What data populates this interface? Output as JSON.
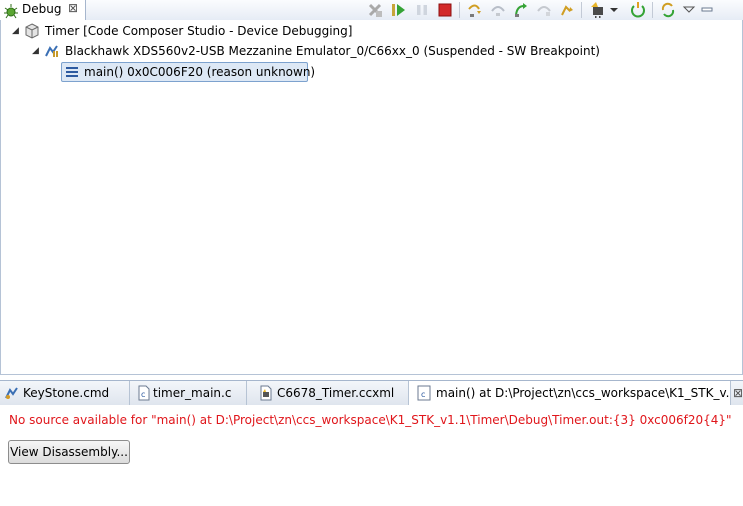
{
  "debug_view": {
    "tab_label": "Debug",
    "tab_close": "⊠",
    "toolbar_icons": [
      "remove-terminated-icon",
      "resume-icon",
      "suspend-icon",
      "terminate-icon",
      "step-into-icon",
      "step-over-icon",
      "step-return-icon",
      "drop-to-frame-icon",
      "use-step-filters-icon",
      "connect-target-icon",
      "dropdown-arrow-icon",
      "reset-cpu-icon",
      "restart-icon",
      "view-menu-icon"
    ],
    "tree": [
      {
        "label": "Timer [Code Composer Studio - Device Debugging]",
        "icon": "launch-cube-icon",
        "expanded": true
      },
      {
        "label": "Blackhawk XDS560v2-USB Mezzanine Emulator_0/C66xx_0 (Suspended - SW Breakpoint)",
        "icon": "suspended-thread-icon",
        "expanded": true
      },
      {
        "label": "main() 0x0C006F20  (reason unknown)",
        "icon": "stack-frame-icon",
        "selected": true
      }
    ]
  },
  "editor": {
    "tabs": [
      {
        "label": "KeyStone.cmd",
        "icon": "cmd-file-icon"
      },
      {
        "label": "timer_main.c",
        "icon": "c-file-icon"
      },
      {
        "label": "C6678_Timer.ccxml",
        "icon": "ccxml-file-icon"
      },
      {
        "label": "main() at D:\\Project\\zn\\ccs_workspace\\K1_STK_v...",
        "icon": "c-file-icon",
        "active": true
      }
    ],
    "close_glyph": "⊠",
    "message": "No source available for \"main() at D:\\Project\\zn\\ccs_workspace\\K1_STK_v1.1\\Timer\\Debug\\Timer.out:{3} 0xc006f20{4}\"",
    "button_label": "View Disassembly..."
  },
  "colors": {
    "error_text": "#e0161b",
    "selection_bg": "#dde8f5",
    "selection_border": "#7da2ce"
  }
}
